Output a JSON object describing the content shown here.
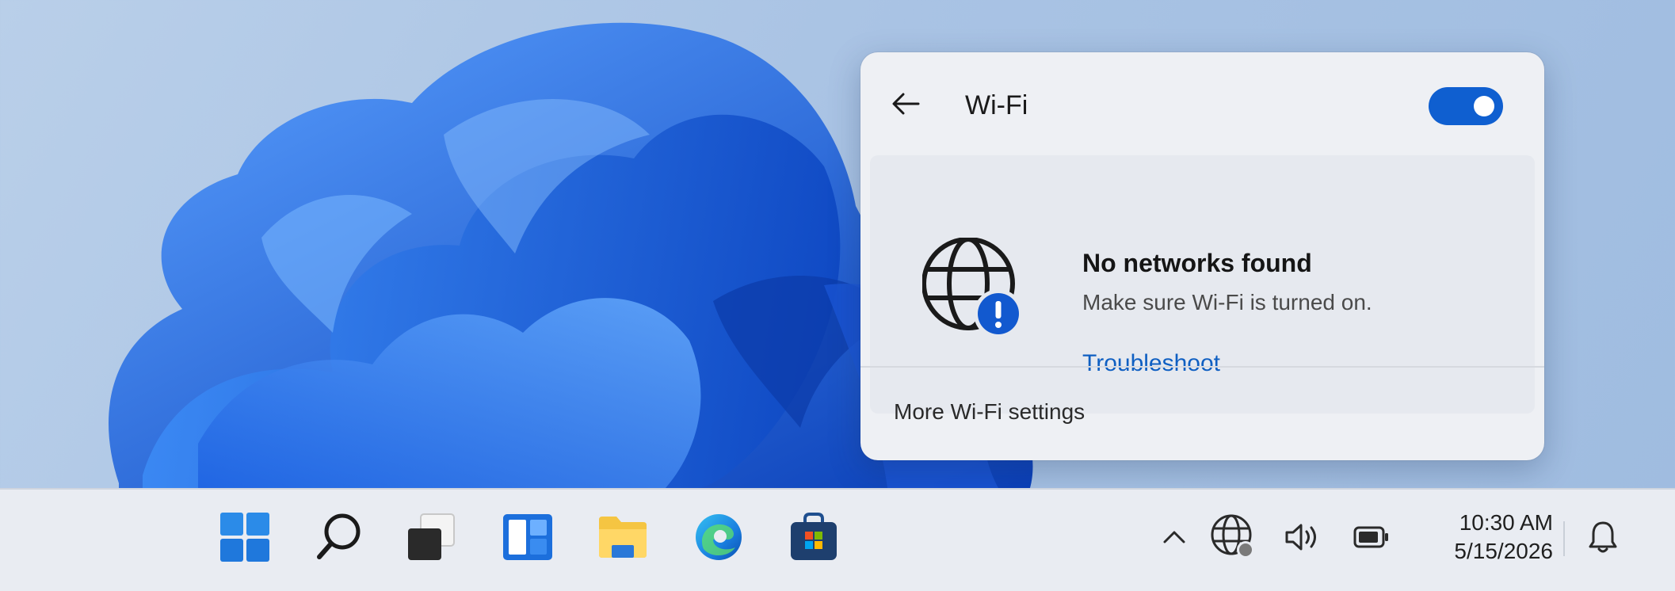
{
  "flyout": {
    "title": "Wi-Fi",
    "toggle_on": true,
    "message_title": "No networks found",
    "message_subtitle": "Make sure Wi-Fi is turned on.",
    "troubleshoot_link": "Troubleshoot",
    "more_settings": "More Wi-Fi settings"
  },
  "taskbar": {
    "apps": [
      {
        "name": "start-icon"
      },
      {
        "name": "search-icon"
      },
      {
        "name": "task-view-icon"
      },
      {
        "name": "widgets-icon"
      },
      {
        "name": "file-explorer-icon"
      },
      {
        "name": "edge-icon"
      },
      {
        "name": "store-icon"
      }
    ],
    "tray": {
      "icons": [
        "chevron-up-icon",
        "network-globe-icon",
        "volume-icon",
        "battery-icon",
        "bell-icon"
      ]
    },
    "time": "10:30 AM",
    "date": "5/15/2026"
  },
  "colors": {
    "accent": "#0f5fd0",
    "link": "#0f5fc2",
    "flyout_bg": "#eef0f4",
    "taskbar_bg": "#e9ecf2"
  }
}
